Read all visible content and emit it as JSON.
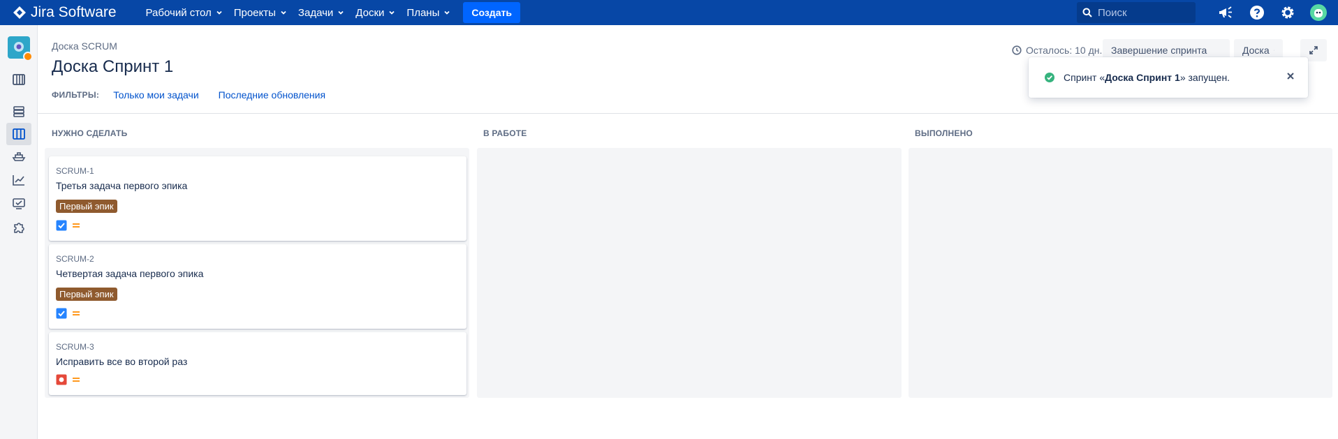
{
  "app": {
    "name": "Jira Software"
  },
  "nav": {
    "items": [
      {
        "label": "Рабочий стол"
      },
      {
        "label": "Проекты"
      },
      {
        "label": "Задачи"
      },
      {
        "label": "Доски"
      },
      {
        "label": "Планы"
      }
    ],
    "create_label": "Создать",
    "search_placeholder": "Поиск"
  },
  "header": {
    "breadcrumb": "Доска SCRUM",
    "title": "Доска Спринт 1",
    "remaining": "Осталось: 10 дн.",
    "complete_sprint": "Завершение спринта",
    "board_menu": "Доска"
  },
  "filters": {
    "label": "ФИЛЬТРЫ:",
    "items": [
      "Только мои задачи",
      "Последние обновления"
    ]
  },
  "flag": {
    "prefix": "Спринт «",
    "name": "Доска Спринт 1",
    "suffix": "» запущен."
  },
  "columns": [
    {
      "title": "НУЖНО СДЕЛАТЬ"
    },
    {
      "title": "В РАБОТЕ"
    },
    {
      "title": "ВЫПОЛНЕНО"
    }
  ],
  "cards": [
    {
      "key": "SCRUM-1",
      "summary": "Третья задача первого эпика",
      "epic": "Первый эпик",
      "type": "task",
      "priority": "medium"
    },
    {
      "key": "SCRUM-2",
      "summary": "Четвертая задача первого эпика",
      "epic": "Первый эпик",
      "type": "task",
      "priority": "medium"
    },
    {
      "key": "SCRUM-3",
      "summary": "Исправить все во второй раз",
      "type": "bug",
      "priority": "medium"
    }
  ],
  "colors": {
    "nav_bg": "#0747a6",
    "create_bg": "#0065ff",
    "epic_bg": "#8f5a2e",
    "task_icon": "#2684ff",
    "bug_icon": "#e5493a",
    "priority_medium": "#ff991f",
    "success": "#36b37e"
  },
  "icons": {
    "sidebar": [
      "project-avatar",
      "backlog-icon",
      "active-sprint-board-icon",
      "releases-icon",
      "reports-icon",
      "issues-icon",
      "components-icon",
      "project-settings-icon"
    ],
    "topbar": [
      "search-icon",
      "announcements-icon",
      "help-icon",
      "settings-icon",
      "user-avatar"
    ]
  }
}
